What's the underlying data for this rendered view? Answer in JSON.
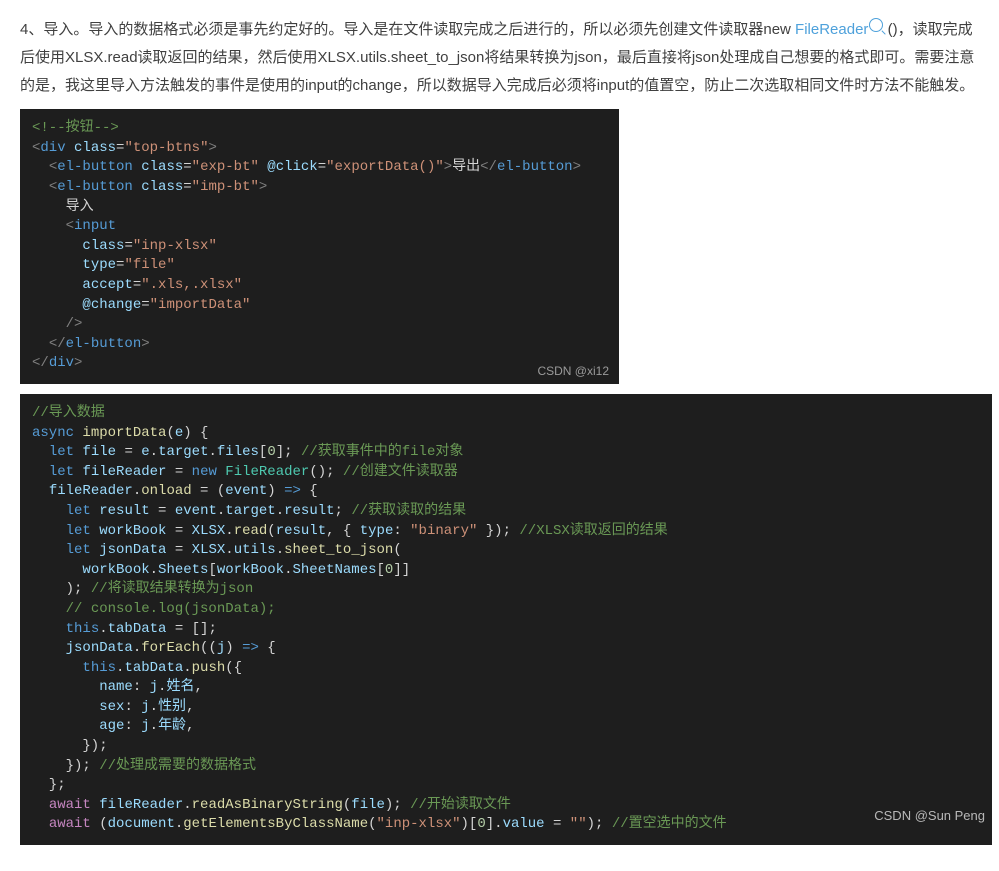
{
  "para": {
    "t1": "4、导入。导入的数据格式必须是事先约定好的。导入是在文件读取完成之后进行的，所以必须先创建文件读取器new ",
    "link": "FileReader",
    "t2": " ()，读取完成后使用XLSX.read读取返回的结果，然后使用XLSX.utils.sheet_to_json将结果转换为json，最后直接将json处理成自己想要的格式即可。需要注意的是，我这里导入方法触发的事件是使用的input的change，所以数据导入完成后必须将input的值置空，防止二次选取相同文件时方法不能触发。"
  },
  "code1": {
    "c_button": "<!--按钮-->",
    "div": "div",
    "class": "class",
    "top_btns": "\"top-btns\"",
    "el_button": "el-button",
    "exp_bt": "\"exp-bt\"",
    "at_click": "@click",
    "exportData": "\"exportData()\"",
    "export_txt": "导出",
    "imp_bt": "\"imp-bt\"",
    "import_txt": "导入",
    "input": "input",
    "inp_xlsx": "\"inp-xlsx\"",
    "type": "type",
    "file": "\"file\"",
    "accept": "accept",
    "accept_v": "\".xls,.xlsx\"",
    "at_change": "@change",
    "importData": "\"importData\"",
    "watermark": "CSDN @xi12"
  },
  "code2": {
    "c_import": "//导入数据",
    "async": "async",
    "importData": "importData",
    "e": "e",
    "let": "let",
    "file": "file",
    "target": "target",
    "files": "files",
    "zero": "0",
    "c_file": "//获取事件中的file对象",
    "fileReader": "fileReader",
    "new": "new",
    "FileReader": "FileReader",
    "c_reader": "//创建文件读取器",
    "onload": "onload",
    "event": "event",
    "result": "result",
    "c_result": "//获取读取的结果",
    "workBook": "workBook",
    "XLSX": "XLSX",
    "read": "read",
    "type": "type",
    "binary": "\"binary\"",
    "c_xlsx": "//XLSX读取返回的结果",
    "jsonData": "jsonData",
    "utils": "utils",
    "sheet_to_json": "sheet_to_json",
    "Sheets": "Sheets",
    "SheetNames": "SheetNames",
    "c_tojson": "//将读取结果转换为json",
    "c_console": "// console.log(jsonData);",
    "this": "this",
    "tabData": "tabData",
    "forEach": "forEach",
    "j": "j",
    "push": "push",
    "name": "name",
    "xingming": "姓名",
    "sex": "sex",
    "xingbie": "性别",
    "age": "age",
    "nianling": "年龄",
    "c_format": "//处理成需要的数据格式",
    "await": "await",
    "readAsBinaryString": "readAsBinaryString",
    "c_start": "//开始读取文件",
    "document": "document",
    "getElementsByClassName": "getElementsByClassName",
    "inp_xlsx": "\"inp-xlsx\"",
    "value": "value",
    "empty": "\"\"",
    "c_clear": "//置空选中的文件"
  },
  "watermark2": "CSDN @Sun Peng"
}
